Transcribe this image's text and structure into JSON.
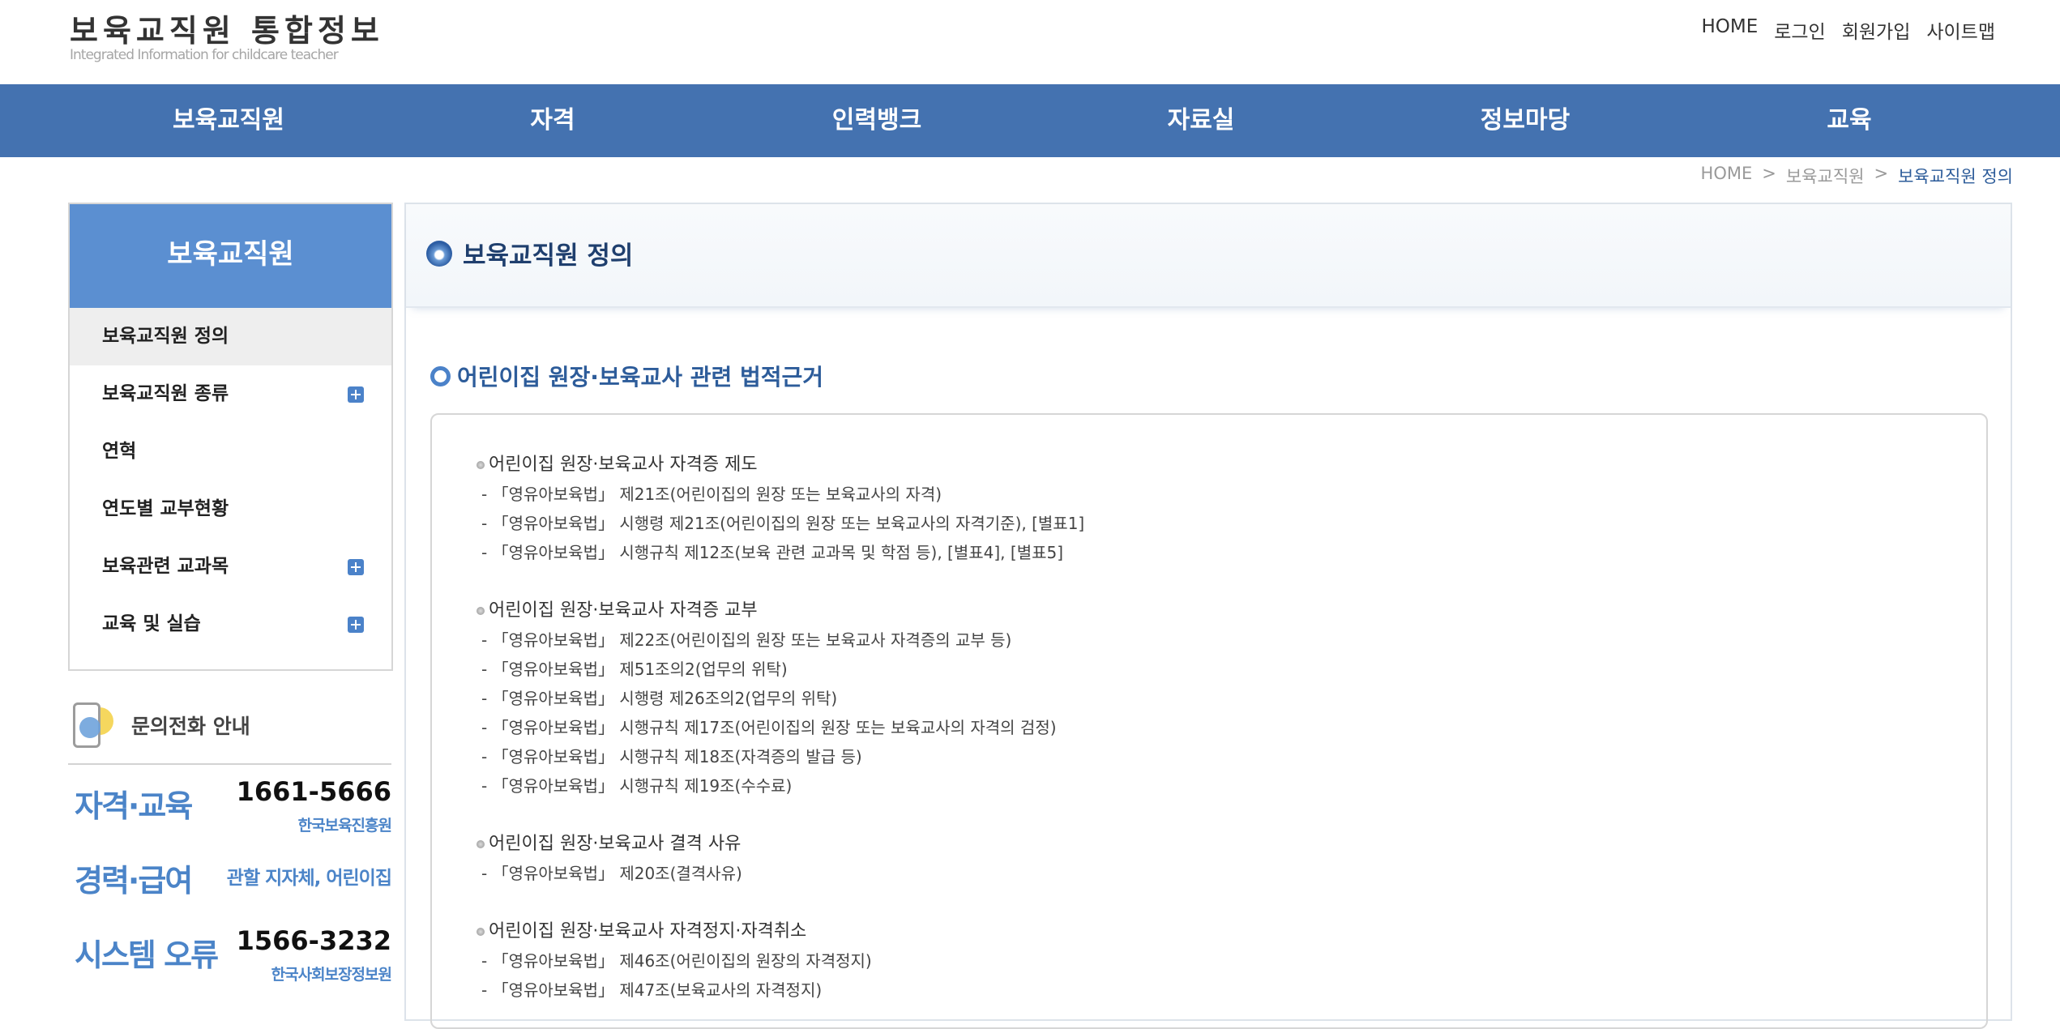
{
  "header": {
    "logo_title": "보육교직원 통합정보",
    "logo_sub": "Integrated Information for childcare teacher",
    "util": [
      "HOME",
      "로그인",
      "회원가입",
      "사이트맵"
    ]
  },
  "gnb": [
    "보육교직원",
    "자격",
    "인력뱅크",
    "자료실",
    "정보마당",
    "교육"
  ],
  "breadcrumb": {
    "home": "HOME",
    "sep1": ">",
    "level1": "보육교직원",
    "sep2": ">",
    "current": "보육교직원 정의"
  },
  "lnb": {
    "title": "보육교직원",
    "items": [
      {
        "label": "보육교직원 정의"
      },
      {
        "label": "보육교직원 종류"
      },
      {
        "label": "연혁"
      },
      {
        "label": "연도별 교부현황"
      },
      {
        "label": "보육관련 교과목"
      },
      {
        "label": "교육 및 실습"
      }
    ]
  },
  "contact": {
    "title": "문의전화 안내",
    "rows": [
      {
        "label": "자격·교육",
        "number": "1661-5666",
        "org": "한국보육진흥원"
      },
      {
        "label": "경력·급여",
        "org": "관할 지자체, 어린이집"
      },
      {
        "label": "시스템 오류",
        "number": "1566-3232",
        "org": "한국사회보장정보원"
      }
    ]
  },
  "content": {
    "page_title": "보육교직원 정의",
    "section_title": "어린이집 원장·보육교사 관련 법적근거",
    "groups": [
      {
        "title": "어린이집 원장·보육교사 자격증 제도",
        "lines": [
          "- 「영유아보육법」 제21조(어린이집의 원장 또는 보육교사의 자격)",
          "- 「영유아보육법」 시행령 제21조(어린이집의 원장 또는 보육교사의 자격기준), [별표1]",
          "- 「영유아보육법」 시행규칙 제12조(보육 관련 교과목 및 학점 등), [별표4], [별표5]"
        ]
      },
      {
        "title": "어린이집 원장·보육교사 자격증 교부",
        "lines": [
          "- 「영유아보육법」 제22조(어린이집의 원장 또는 보육교사 자격증의 교부 등)",
          "- 「영유아보육법」 제51조의2(업무의 위탁)",
          "- 「영유아보육법」 시행령 제26조의2(업무의 위탁)",
          "- 「영유아보육법」 시행규칙 제17조(어린이집의 원장 또는 보육교사의 자격의 검정)",
          "- 「영유아보육법」 시행규칙 제18조(자격증의 발급 등)",
          "- 「영유아보육법」 시행규칙 제19조(수수료)"
        ]
      },
      {
        "title": "어린이집 원장·보육교사 결격 사유",
        "lines": [
          "- 「영유아보육법」 제20조(결격사유)"
        ]
      },
      {
        "title": "어린이집 원장·보육교사 자격정지·자격취소",
        "lines": [
          "- 「영유아보육법」 제46조(어린이집의 원장의 자격정지)",
          "- 「영유아보육법」 제47조(보육교사의 자격정지)"
        ]
      }
    ]
  }
}
